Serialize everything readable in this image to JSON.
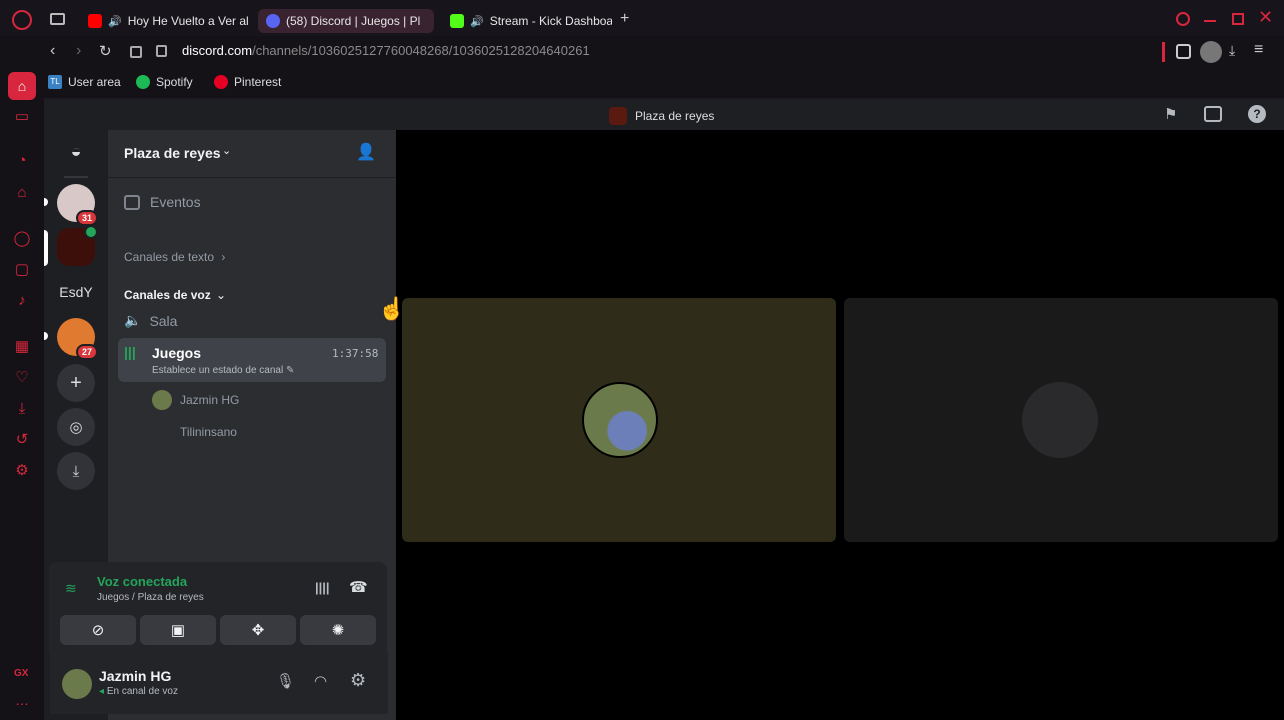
{
  "browser": {
    "tabs": [
      {
        "label": "Hoy He Vuelto a Ver al",
        "color": "#ff0000"
      },
      {
        "label": "(58) Discord | Juegos | Pl",
        "color": "#5865f2"
      },
      {
        "label": "Stream - Kick Dashboa",
        "color": "#53fc18"
      }
    ],
    "url_domain": "discord.com",
    "url_path": "/channels/1036025127760048268/1036025128204640261",
    "bookmarks": [
      {
        "label": "User area",
        "icon": "tl-icon"
      },
      {
        "label": "Spotify",
        "icon": "spotify-icon"
      },
      {
        "label": "Pinterest",
        "icon": "pinterest-icon"
      }
    ],
    "gx_label": "GX"
  },
  "discord": {
    "window_title": "Plaza de reyes",
    "servers": [
      {
        "badge": "31"
      },
      {
        "badge": ""
      },
      {
        "label": "EsdY"
      },
      {
        "badge": "27"
      }
    ],
    "server_name": "Plaza de reyes",
    "events_label": "Eventos",
    "text_channels_label": "Canales de texto",
    "voice_channels_label": "Canales de voz",
    "voice_channels": [
      {
        "name": "Sala"
      },
      {
        "name": "Juegos",
        "timer": "1:37:58",
        "status": "Establece un estado de canal"
      }
    ],
    "voice_members": [
      "Jazmin HG",
      "Tilininsano"
    ],
    "voice_panel": {
      "title": "Voz conectada",
      "subtitle": "Juegos / Plaza de reyes"
    },
    "user": {
      "name": "Jazmin HG",
      "status": "En canal de voz"
    }
  },
  "colors": {
    "opera_red": "#d7263d",
    "voice_green": "#23a55a",
    "tile_active": "#2f2d1a",
    "tile_idle": "#1a1a1b"
  }
}
